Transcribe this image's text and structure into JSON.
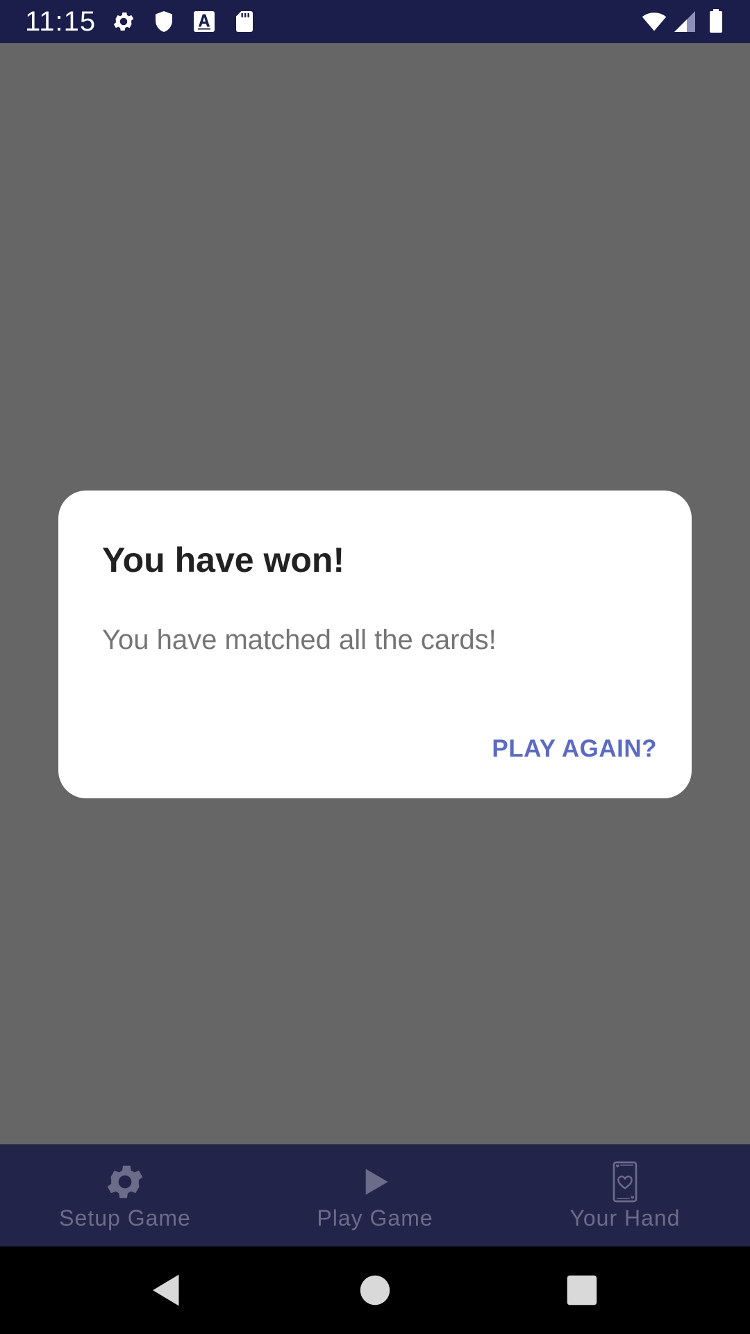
{
  "status_bar": {
    "time": "11:15",
    "left_icons": [
      "settings-icon",
      "shield-icon",
      "font-a-icon",
      "sd-card-icon"
    ],
    "right_icons": [
      "wifi-icon",
      "signal-icon",
      "battery-icon"
    ]
  },
  "dialog": {
    "title": "You have won!",
    "message": "You have matched all the cards!",
    "action_label": "PLAY AGAIN?"
  },
  "bottom_nav": {
    "items": [
      {
        "label": "Setup Game",
        "icon": "gear-icon"
      },
      {
        "label": "Play Game",
        "icon": "play-icon"
      },
      {
        "label": "Your Hand",
        "icon": "card-heart-icon"
      }
    ]
  },
  "system_nav": {
    "buttons": [
      "back-icon",
      "home-icon",
      "recents-icon"
    ]
  },
  "colors": {
    "status_bar": "#1b1d4a",
    "scrim": "#666666",
    "dialog_bg": "#ffffff",
    "accent": "#5c6bc0",
    "bottom_nav": "#23244a",
    "nav_inactive": "#6b6c8a",
    "system_nav": "#000000"
  }
}
